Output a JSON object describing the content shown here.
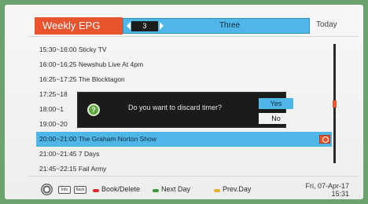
{
  "header": {
    "title": "Weekly EPG",
    "channel_number": "3",
    "channel_name": "Three",
    "day": "Today"
  },
  "programmes": [
    {
      "text": "15:30~16:00 Sticky TV",
      "selected": false
    },
    {
      "text": "16:00~16:25 Newshub Live At 4pm",
      "selected": false
    },
    {
      "text": "16:25~17:25 The Blocktagon",
      "selected": false
    },
    {
      "text": "17:25~18",
      "selected": false
    },
    {
      "text": "18:00~1",
      "selected": false
    },
    {
      "text": "19:00~20",
      "selected": false
    },
    {
      "text": "20:00~21:00 The Graham Norton Show",
      "selected": true
    },
    {
      "text": "21:00~21:45 7 Days",
      "selected": false
    },
    {
      "text": "21:45~22:15 Fail Army",
      "selected": false
    }
  ],
  "dialog": {
    "icon": "question-icon",
    "icon_glyph": "?",
    "message": "Do you want to discard timer?",
    "yes_label": "Yes",
    "no_label": "No"
  },
  "footer": {
    "info_key": "Info",
    "back_key": "Back",
    "red_label": "Book/Delete",
    "green_label": "Next Day",
    "yellow_label": "Prev.Day"
  },
  "datetime": {
    "date": "Fri, 07-Apr-17",
    "time": "15:31"
  },
  "colors": {
    "accent_orange": "#e8542e",
    "highlight_blue": "#4fb6e8",
    "red_key": "#e0262b",
    "green_key": "#3a9a3a",
    "yellow_key": "#e3b230"
  }
}
